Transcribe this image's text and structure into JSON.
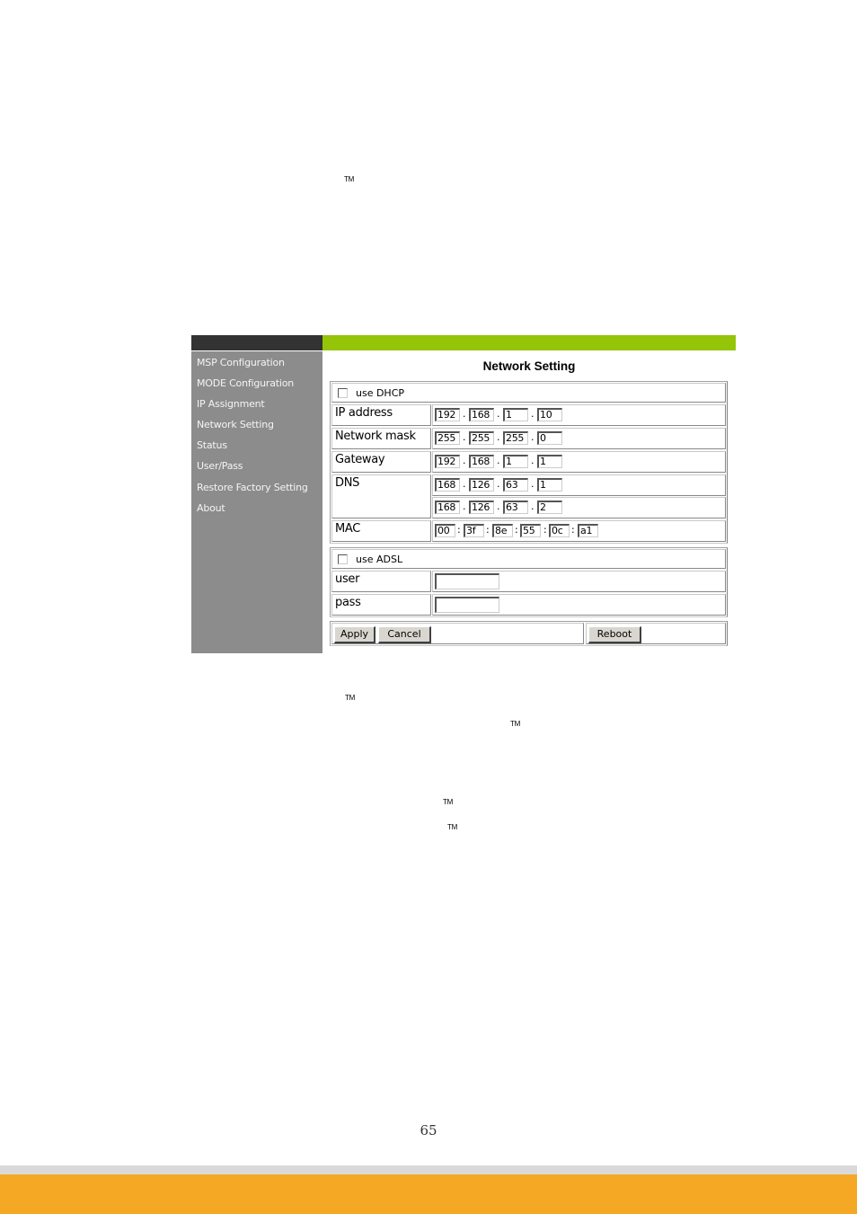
{
  "document": {
    "trademark_marks": [
      "TM",
      "TM",
      "TM",
      "TM",
      "TM"
    ],
    "page_number": "65"
  },
  "screenshot": {
    "sidebar": {
      "items": [
        {
          "label": "MSP Configuration"
        },
        {
          "label": "MODE Configuration"
        },
        {
          "label": "IP Assignment"
        },
        {
          "label": "Network Setting"
        },
        {
          "label": "Status"
        },
        {
          "label": "User/Pass"
        },
        {
          "label": "Restore Factory Setting"
        },
        {
          "label": "About"
        }
      ]
    },
    "title": "Network Setting",
    "dhcp": {
      "checkbox_label": "use DHCP",
      "checked": false
    },
    "ip_address": {
      "label": "IP address",
      "octets": [
        "192",
        "168",
        "1",
        "10"
      ]
    },
    "network_mask": {
      "label": "Network mask",
      "octets": [
        "255",
        "255",
        "255",
        "0"
      ]
    },
    "gateway": {
      "label": "Gateway",
      "octets": [
        "192",
        "168",
        "1",
        "1"
      ]
    },
    "dns": {
      "label": "DNS",
      "primary": [
        "168",
        "126",
        "63",
        "1"
      ],
      "secondary": [
        "168",
        "126",
        "63",
        "2"
      ]
    },
    "mac": {
      "label": "MAC",
      "bytes": [
        "00",
        "3f",
        "8e",
        "55",
        "0c",
        "a1"
      ]
    },
    "separators": {
      "ip": ".",
      "mac": ":"
    },
    "adsl": {
      "checkbox_label": "use ADSL",
      "checked": false,
      "user_label": "user",
      "user_value": "",
      "pass_label": "pass",
      "pass_value": ""
    },
    "buttons": {
      "apply": "Apply",
      "cancel": "Cancel",
      "reboot": "Reboot"
    },
    "colors": {
      "header_dark": "#333333",
      "header_green": "#94c508",
      "sidebar": "#8c8c8c",
      "footer_gray": "#d9d9d9",
      "footer_orange": "#f5a823"
    }
  }
}
